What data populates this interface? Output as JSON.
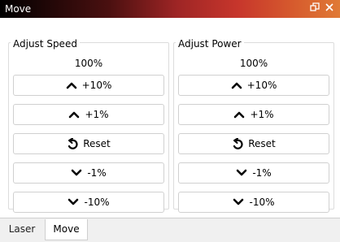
{
  "window": {
    "title": "Move"
  },
  "speed": {
    "title": "Adjust Speed",
    "percent": "100%",
    "buttons": [
      {
        "label": "+10%",
        "icon": "chevron-up-icon"
      },
      {
        "label": "+1%",
        "icon": "chevron-up-icon"
      },
      {
        "label": "Reset",
        "icon": "reset-icon"
      },
      {
        "label": "-1%",
        "icon": "chevron-down-icon"
      },
      {
        "label": "-10%",
        "icon": "chevron-down-icon"
      }
    ]
  },
  "power": {
    "title": "Adjust Power",
    "percent": "100%",
    "buttons": [
      {
        "label": "+10%",
        "icon": "chevron-up-icon"
      },
      {
        "label": "+1%",
        "icon": "chevron-up-icon"
      },
      {
        "label": "Reset",
        "icon": "reset-icon"
      },
      {
        "label": "-1%",
        "icon": "chevron-down-icon"
      },
      {
        "label": "-10%",
        "icon": "chevron-down-icon"
      }
    ]
  },
  "tabs": [
    {
      "label": "Laser",
      "active": false
    },
    {
      "label": "Move",
      "active": true
    }
  ]
}
